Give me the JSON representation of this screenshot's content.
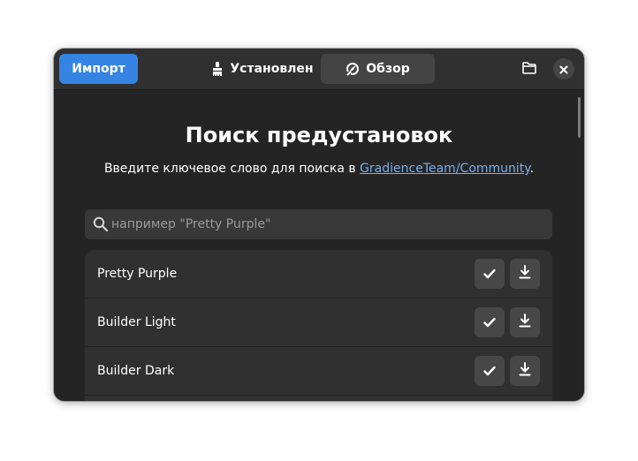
{
  "header": {
    "import_label": "Импорт",
    "tabs": [
      {
        "label": "Установлен",
        "icon": "brush-icon"
      },
      {
        "label": "Обзор",
        "icon": "explore-icon"
      }
    ],
    "folder_icon": "folder-icon",
    "close_icon": "close-icon"
  },
  "main": {
    "title": "Поиск предустановок",
    "subtitle_prefix": "Введите ключевое слово для поиска в ",
    "subtitle_link": "GradienceTeam/Community",
    "subtitle_suffix": ".",
    "search": {
      "placeholder": "например \"Pretty Purple\"",
      "value": ""
    },
    "presets": [
      {
        "name": "Pretty Purple"
      },
      {
        "name": "Builder Light"
      },
      {
        "name": "Builder Dark"
      },
      {
        "name": ""
      }
    ]
  },
  "colors": {
    "accent": "#3584e4",
    "link": "#78aeed",
    "window_bg": "#242424",
    "header_bg": "#303030"
  }
}
